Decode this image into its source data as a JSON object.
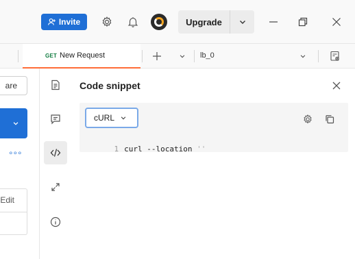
{
  "topbar": {
    "invite_label": "Invite",
    "upgrade_label": "Upgrade"
  },
  "tabs": {
    "active": {
      "method": "GET",
      "title": "New Request"
    },
    "environment": "lb_0"
  },
  "left_panel": {
    "share_label": "are",
    "more_label": "∘∘∘",
    "edit_label": "Edit"
  },
  "snippet": {
    "title": "Code snippet",
    "language": "cURL",
    "line_number": "1",
    "code": "curl --location ",
    "code_string": "''"
  },
  "colors": {
    "accent_blue": "#1f6fd6",
    "active_tab_underline": "#ff6c37",
    "get_method": "#0f7b3f"
  }
}
